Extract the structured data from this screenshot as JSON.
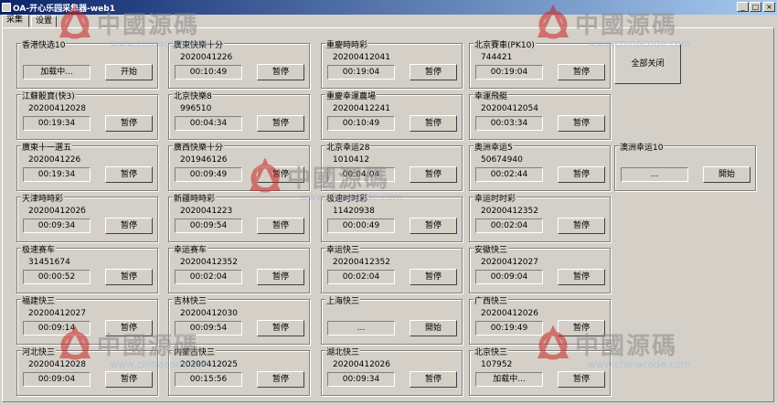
{
  "window": {
    "title": "OA-开心乐园采集器-web1",
    "minimize": "_",
    "maximize": "□",
    "close": "×"
  },
  "tabs": [
    {
      "label": "采集"
    },
    {
      "label": "设置"
    }
  ],
  "close_all_label": "全部关闭",
  "watermark": {
    "text": "中國源碼",
    "url": "www.chinacode.com"
  },
  "colors": {
    "accent": "#0a246a",
    "watermark_red": "#cc2222"
  },
  "groups": [
    {
      "name": "香港快选10",
      "issue": "",
      "time": "加载中...",
      "button": "开始"
    },
    {
      "name": "廣東快樂十分",
      "issue": "2020041226",
      "time": "00:10:49",
      "button": "暂停"
    },
    {
      "name": "重慶時時彩",
      "issue": "20200412041",
      "time": "00:19:04",
      "button": "暂停"
    },
    {
      "name": "北京賽車(PK10)",
      "issue": "744421",
      "time": "00:19:04",
      "button": "暂停"
    },
    {
      "name": "江蘇骰寶(快3)",
      "issue": "20200412028",
      "time": "00:19:34",
      "button": "暂停"
    },
    {
      "name": "北京快樂8",
      "issue": "996510",
      "time": "00:04:34",
      "button": "暂停"
    },
    {
      "name": "重慶幸運農場",
      "issue": "20200412241",
      "time": "00:10:49",
      "button": "暂停"
    },
    {
      "name": "幸運飛艇",
      "issue": "20200412054",
      "time": "00:03:34",
      "button": "暂停"
    },
    {
      "name": "廣東十一選五",
      "issue": "2020041226",
      "time": "00:19:34",
      "button": "暂停"
    },
    {
      "name": "廣西快樂十分",
      "issue": "201946126",
      "time": "00:09:49",
      "button": "暂停"
    },
    {
      "name": "北京幸运28",
      "issue": "1010412",
      "time": "00:04:04",
      "button": "暂停"
    },
    {
      "name": "奥洲幸运5",
      "issue": "50674940",
      "time": "00:02:44",
      "button": "暂停"
    },
    {
      "name": "澳洲幸运10",
      "issue": "",
      "time": "...",
      "button": "開始"
    },
    {
      "name": "天津時時彩",
      "issue": "2020041202б",
      "time": "00:09:34",
      "button": "暂停"
    },
    {
      "name": "新疆時時彩",
      "issue": "2020041223",
      "time": "00:09:54",
      "button": "暂停"
    },
    {
      "name": "极速时时彩",
      "issue": "11420938",
      "time": "00:00:49",
      "button": "暂停"
    },
    {
      "name": "幸运时时彩",
      "issue": "20200412352",
      "time": "00:02:04",
      "button": "暂停"
    },
    {
      "name": "极速赛车",
      "issue": "31451674",
      "time": "00:00:52",
      "button": "暂停"
    },
    {
      "name": "幸运赛车",
      "issue": "20200412352",
      "time": "00:02:04",
      "button": "暂停"
    },
    {
      "name": "幸运快三",
      "issue": "20200412352",
      "time": "00:02:04",
      "button": "暂停"
    },
    {
      "name": "安徽快三",
      "issue": "20200412027",
      "time": "00:09:04",
      "button": "暂停"
    },
    {
      "name": "福建快三",
      "issue": "20200412027",
      "time": "00:09:14",
      "button": "暂停"
    },
    {
      "name": "吉林快三",
      "issue": "20200412030",
      "time": "00:09:54",
      "button": "暂停"
    },
    {
      "name": "上海快三",
      "issue": "",
      "time": "...",
      "button": "開始"
    },
    {
      "name": "广西快三",
      "issue": "20200412026",
      "time": "00:19:49",
      "button": "暂停"
    },
    {
      "name": "河北快三",
      "issue": "20200412028",
      "time": "00:09:04",
      "button": "暂停"
    },
    {
      "name": "内蒙古快三",
      "issue": "20200412025",
      "time": "00:15:56",
      "button": "暂停"
    },
    {
      "name": "湖北快三",
      "issue": "20200412026",
      "time": "00:09:34",
      "button": "暂停"
    },
    {
      "name": "北京快三",
      "issue": "107952",
      "time": "加载中...",
      "button": "暂停"
    }
  ]
}
